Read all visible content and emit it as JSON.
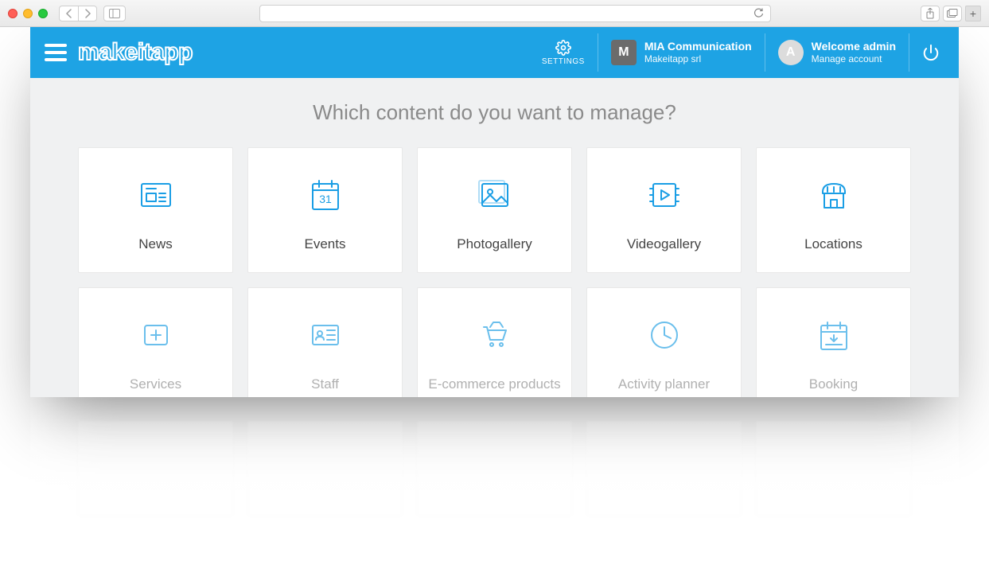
{
  "header": {
    "logo": "makeitapp",
    "settings_label": "SETTINGS",
    "org": {
      "initial": "M",
      "name": "MIA Communication",
      "sub": "Makeitapp srl"
    },
    "user": {
      "initial": "A",
      "welcome": "Welcome admin",
      "sub": "Manage account"
    }
  },
  "page": {
    "title": "Which content do you want to manage?"
  },
  "cards": [
    {
      "id": "news",
      "label": "News",
      "state": "active"
    },
    {
      "id": "events",
      "label": "Events",
      "state": "active"
    },
    {
      "id": "photogallery",
      "label": "Photogallery",
      "state": "active"
    },
    {
      "id": "videogallery",
      "label": "Videogallery",
      "state": "active"
    },
    {
      "id": "locations",
      "label": "Locations",
      "state": "active"
    },
    {
      "id": "services",
      "label": "Services",
      "state": "muted"
    },
    {
      "id": "staff",
      "label": "Staff",
      "state": "muted"
    },
    {
      "id": "ecommerce",
      "label": "E-commerce products",
      "state": "muted"
    },
    {
      "id": "activity",
      "label": "Activity planner",
      "state": "muted"
    },
    {
      "id": "booking",
      "label": "Booking",
      "state": "muted"
    }
  ],
  "colors": {
    "brand": "#1ea3e4",
    "icon_active": "#1a9ee5",
    "icon_muted": "#6bbfec"
  }
}
